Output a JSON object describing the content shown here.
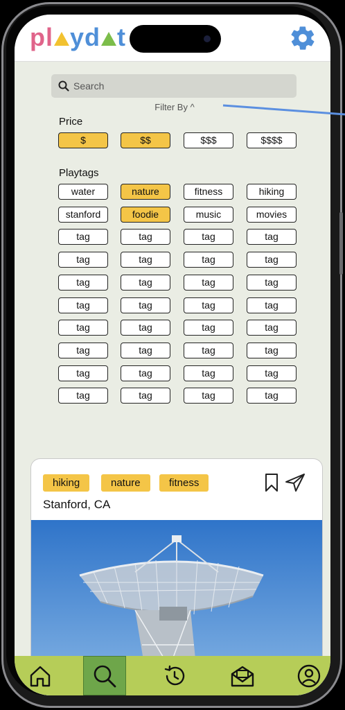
{
  "app": {
    "logo_parts": [
      "p",
      "l",
      "y",
      "d",
      "t"
    ]
  },
  "search": {
    "placeholder": "Search"
  },
  "filter": {
    "toggle_label": "Filter By ^",
    "price_label": "Price",
    "price_options": [
      {
        "label": "$",
        "selected": true
      },
      {
        "label": "$$",
        "selected": true
      },
      {
        "label": "$$$",
        "selected": false
      },
      {
        "label": "$$$$",
        "selected": false
      }
    ],
    "playtags_label": "Playtags",
    "playtags": [
      {
        "label": "water",
        "selected": false
      },
      {
        "label": "nature",
        "selected": true
      },
      {
        "label": "fitness",
        "selected": false
      },
      {
        "label": "hiking",
        "selected": false
      },
      {
        "label": "stanford",
        "selected": false
      },
      {
        "label": "foodie",
        "selected": true
      },
      {
        "label": "music",
        "selected": false
      },
      {
        "label": "movies",
        "selected": false
      },
      {
        "label": "tag",
        "selected": false
      },
      {
        "label": "tag",
        "selected": false
      },
      {
        "label": "tag",
        "selected": false
      },
      {
        "label": "tag",
        "selected": false
      },
      {
        "label": "tag",
        "selected": false
      },
      {
        "label": "tag",
        "selected": false
      },
      {
        "label": "tag",
        "selected": false
      },
      {
        "label": "tag",
        "selected": false
      },
      {
        "label": "tag",
        "selected": false
      },
      {
        "label": "tag",
        "selected": false
      },
      {
        "label": "tag",
        "selected": false
      },
      {
        "label": "tag",
        "selected": false
      },
      {
        "label": "tag",
        "selected": false
      },
      {
        "label": "tag",
        "selected": false
      },
      {
        "label": "tag",
        "selected": false
      },
      {
        "label": "tag",
        "selected": false
      },
      {
        "label": "tag",
        "selected": false
      },
      {
        "label": "tag",
        "selected": false
      },
      {
        "label": "tag",
        "selected": false
      },
      {
        "label": "tag",
        "selected": false
      },
      {
        "label": "tag",
        "selected": false
      },
      {
        "label": "tag",
        "selected": false
      },
      {
        "label": "tag",
        "selected": false
      },
      {
        "label": "tag",
        "selected": false
      },
      {
        "label": "tag",
        "selected": false
      },
      {
        "label": "tag",
        "selected": false
      },
      {
        "label": "tag",
        "selected": false
      },
      {
        "label": "tag",
        "selected": false
      },
      {
        "label": "tag",
        "selected": false
      },
      {
        "label": "tag",
        "selected": false
      },
      {
        "label": "tag",
        "selected": false
      },
      {
        "label": "tag",
        "selected": false
      }
    ]
  },
  "card": {
    "tags": [
      "hiking",
      "nature",
      "fitness"
    ],
    "location": "Stanford, CA",
    "icons": [
      "bookmark-icon",
      "send-icon"
    ]
  },
  "nav": {
    "items": [
      "home-icon",
      "search-icon",
      "history-icon",
      "inbox-icon",
      "profile-icon"
    ],
    "active": "search-icon"
  },
  "colors": {
    "selected": "#f4c547",
    "nav_bar": "#b6cd58",
    "nav_active": "#6ea64a",
    "gear": "#4f8fd8",
    "background": "#eaede4"
  }
}
